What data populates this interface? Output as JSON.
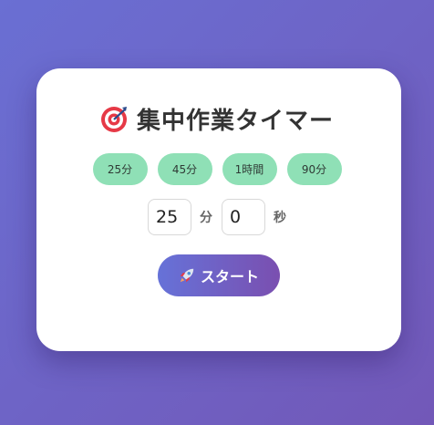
{
  "header": {
    "title": "集中作業タイマー",
    "icon": "target-icon"
  },
  "presets": [
    {
      "label": "25分"
    },
    {
      "label": "45分"
    },
    {
      "label": "1時間"
    },
    {
      "label": "90分"
    }
  ],
  "time": {
    "minutes": "25",
    "minutes_unit": "分",
    "seconds": "0",
    "seconds_unit": "秒"
  },
  "start_button": {
    "label": "スタート",
    "icon": "rocket-icon"
  },
  "colors": {
    "background_start": "#6a6fd3",
    "background_end": "#7258b8",
    "preset": "#8fe0b6",
    "button_start": "#6672d8",
    "button_end": "#7a4fb0"
  }
}
